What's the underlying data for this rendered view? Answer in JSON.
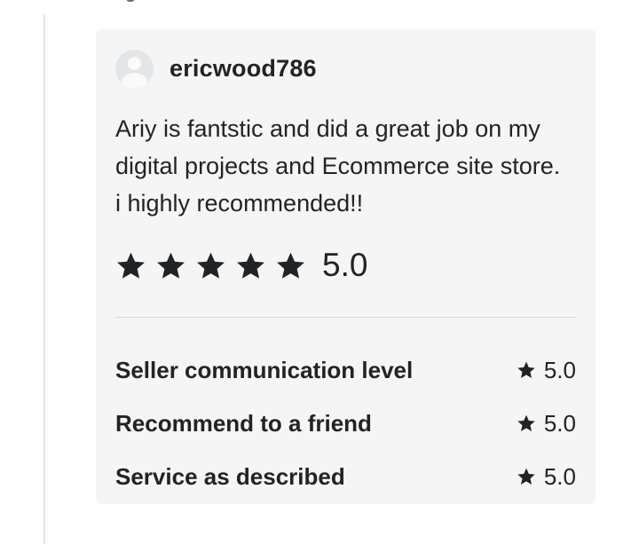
{
  "review": {
    "username": "ericwood786",
    "text": "Ariy is fantstic and did a great job on my digital projects and Ecommerce site store. i highly recommended!!",
    "overall_rating": "5.0",
    "stars_filled": 5,
    "stars_total": 5,
    "criteria": [
      {
        "label": "Seller communication level",
        "score": "5.0"
      },
      {
        "label": "Recommend to a friend",
        "score": "5.0"
      },
      {
        "label": "Service as described",
        "score": "5.0"
      }
    ]
  },
  "colors": {
    "card_background": "#f5f5f5",
    "text": "#222325",
    "star": "#222325",
    "avatar": "#e4e5e7"
  },
  "icons": {
    "avatar": "user-placeholder-icon",
    "star": "star-icon"
  }
}
